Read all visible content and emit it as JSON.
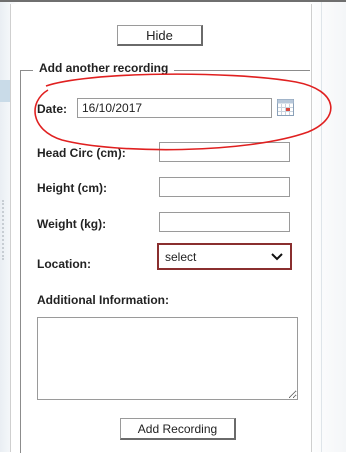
{
  "panel": {
    "hide_label": "Hide",
    "legend": "Add another recording"
  },
  "form": {
    "date_label": "Date:",
    "date_value": "16/10/2017",
    "head_circ_label": "Head Circ (cm):",
    "height_label": "Height (cm):",
    "weight_label": "Weight (kg):",
    "location_label": "Location:",
    "location_selected": "select",
    "additional_info_label": "Additional Information:",
    "add_recording_label": "Add Recording"
  },
  "icons": {
    "calendar": "calendar-icon",
    "chevron": "chevron-down-icon"
  },
  "colors": {
    "highlight_circle": "#e02020",
    "select_border": "#8a2f2f"
  }
}
